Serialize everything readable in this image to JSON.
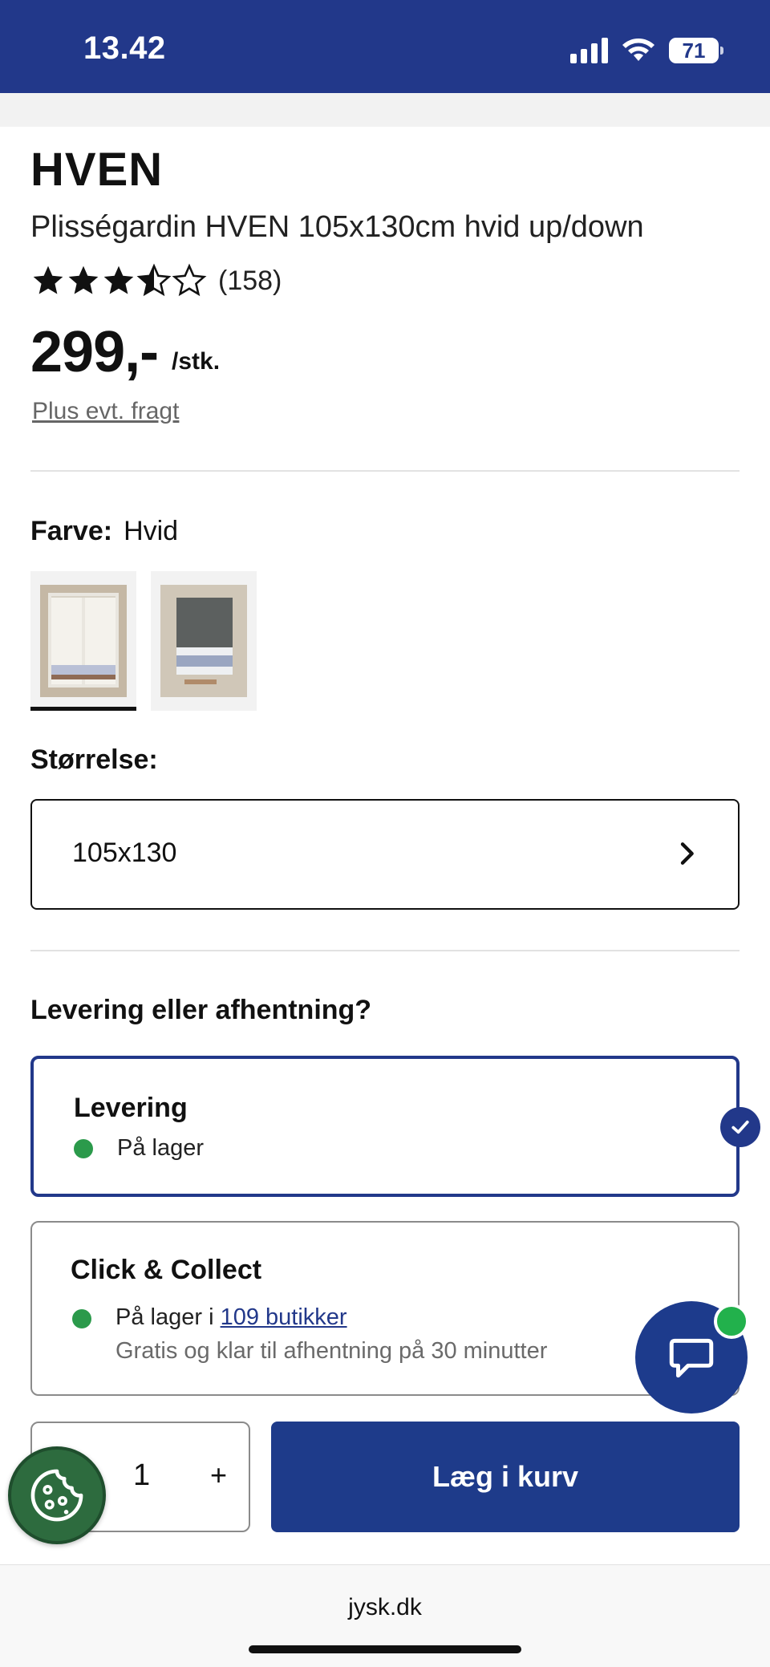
{
  "status_bar": {
    "time": "13.42",
    "battery": "71"
  },
  "product": {
    "brand": "HVEN",
    "name": "Plisségardin HVEN 105x130cm hvid up/down",
    "rating": 3.5,
    "rating_count": "(158)",
    "price": "299,-",
    "unit": "/stk.",
    "freight_link": "Plus evt. fragt"
  },
  "color": {
    "label": "Farve:",
    "value": "Hvid",
    "swatches": [
      {
        "name": "Hvid",
        "selected": true
      },
      {
        "name": "Grå",
        "selected": false
      }
    ]
  },
  "size": {
    "label": "Størrelse:",
    "value": "105x130"
  },
  "delivery": {
    "title": "Levering eller afhentning?",
    "options": [
      {
        "title": "Levering",
        "status": "På lager",
        "selected": true
      },
      {
        "title": "Click & Collect",
        "status_prefix": "På lager i ",
        "status_link": "109 butikker",
        "subtext": "Gratis og klar til afhentning på 30 minutter",
        "selected": false
      }
    ]
  },
  "cart": {
    "quantity": "1",
    "plus": "+",
    "add_button": "Læg i kurv"
  },
  "browser": {
    "url": "jysk.dk"
  },
  "colors": {
    "brand_blue": "#22388a",
    "button_blue": "#1e3b8a",
    "in_stock_green": "#2b9a4b",
    "cookie_green": "#2d6b3e"
  }
}
